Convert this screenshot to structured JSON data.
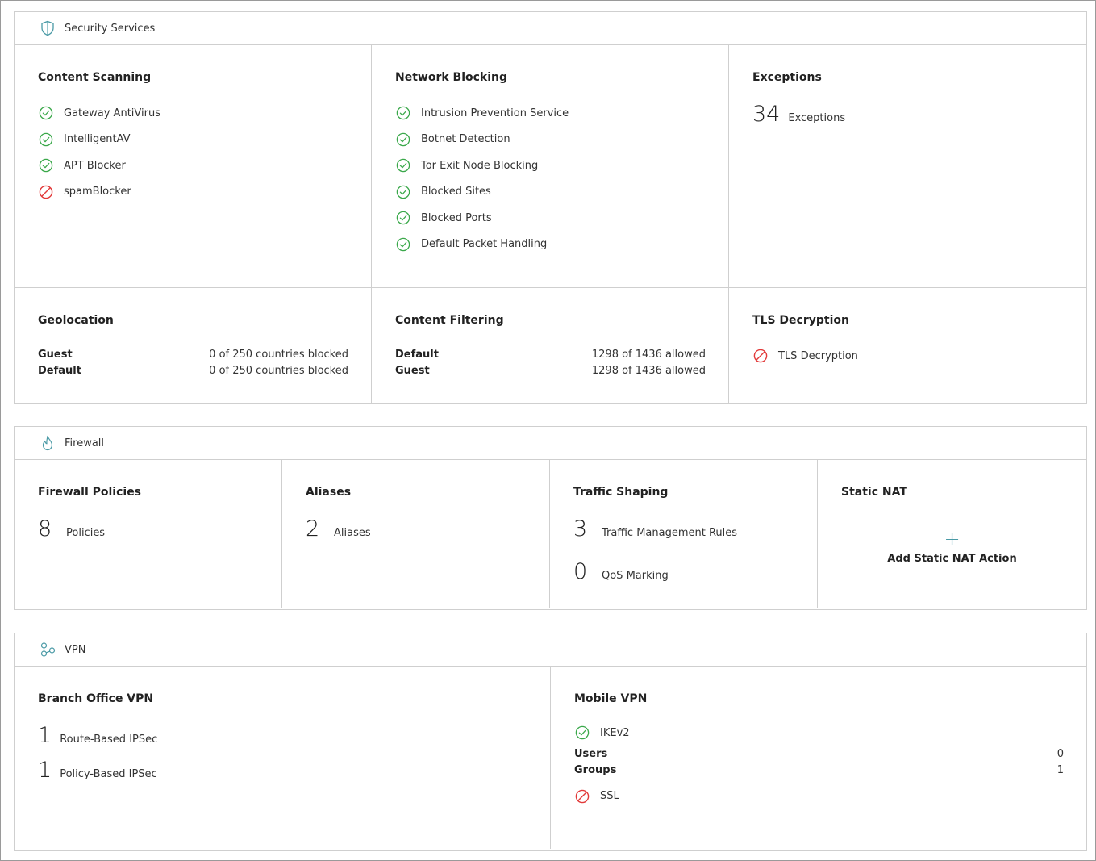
{
  "security": {
    "header": "Security Services",
    "content_scanning": {
      "title": "Content Scanning",
      "items": [
        {
          "label": "Gateway AntiVirus",
          "status": "enabled"
        },
        {
          "label": "IntelligentAV",
          "status": "enabled"
        },
        {
          "label": "APT Blocker",
          "status": "enabled"
        },
        {
          "label": "spamBlocker",
          "status": "disabled"
        }
      ]
    },
    "network_blocking": {
      "title": "Network Blocking",
      "items": [
        {
          "label": "Intrusion Prevention Service",
          "status": "enabled"
        },
        {
          "label": "Botnet Detection",
          "status": "enabled"
        },
        {
          "label": "Tor Exit Node Blocking",
          "status": "enabled"
        },
        {
          "label": "Blocked Sites",
          "status": "enabled"
        },
        {
          "label": "Blocked Ports",
          "status": "enabled"
        },
        {
          "label": "Default Packet Handling",
          "status": "enabled"
        }
      ]
    },
    "exceptions": {
      "title": "Exceptions",
      "count": "34",
      "label": "Exceptions"
    },
    "geolocation": {
      "title": "Geolocation",
      "rows": [
        {
          "key": "Guest",
          "value": "0 of 250 countries blocked"
        },
        {
          "key": "Default",
          "value": "0 of 250 countries blocked"
        }
      ]
    },
    "content_filtering": {
      "title": "Content Filtering",
      "rows": [
        {
          "key": "Default",
          "value": "1298 of 1436 allowed"
        },
        {
          "key": "Guest",
          "value": "1298 of 1436 allowed"
        }
      ]
    },
    "tls": {
      "title": "TLS Decryption",
      "items": [
        {
          "label": "TLS Decryption",
          "status": "disabled"
        }
      ]
    }
  },
  "firewall": {
    "header": "Firewall",
    "policies": {
      "title": "Firewall Policies",
      "count": "8",
      "label": "Policies"
    },
    "aliases": {
      "title": "Aliases",
      "count": "2",
      "label": "Aliases"
    },
    "traffic_shaping": {
      "title": "Traffic Shaping",
      "stats": [
        {
          "count": "3",
          "label": "Traffic Management Rules"
        },
        {
          "count": "0",
          "label": "QoS Marking"
        }
      ]
    },
    "static_nat": {
      "title": "Static NAT",
      "add_label": "Add Static NAT Action",
      "add_icon": "+"
    }
  },
  "vpn": {
    "header": "VPN",
    "branch_office": {
      "title": "Branch Office VPN",
      "stats": [
        {
          "count": "1",
          "label": "Route-Based IPSec"
        },
        {
          "count": "1",
          "label": "Policy-Based IPSec"
        }
      ]
    },
    "mobile": {
      "title": "Mobile VPN",
      "ikev2": {
        "label": "IKEv2",
        "status": "enabled"
      },
      "rows": [
        {
          "key": "Users",
          "value": "0"
        },
        {
          "key": "Groups",
          "value": "1"
        }
      ],
      "ssl": {
        "label": "SSL",
        "status": "disabled"
      }
    }
  },
  "colors": {
    "enabled": "#3aa84a",
    "disabled": "#e23a3a",
    "accent": "#4a9aa6",
    "border": "#cfcfcf"
  },
  "icons": {
    "security": "shield-icon",
    "firewall": "flame-icon",
    "vpn": "vpn-network-icon",
    "enabled": "check-circle-icon",
    "disabled": "prohibited-icon"
  }
}
